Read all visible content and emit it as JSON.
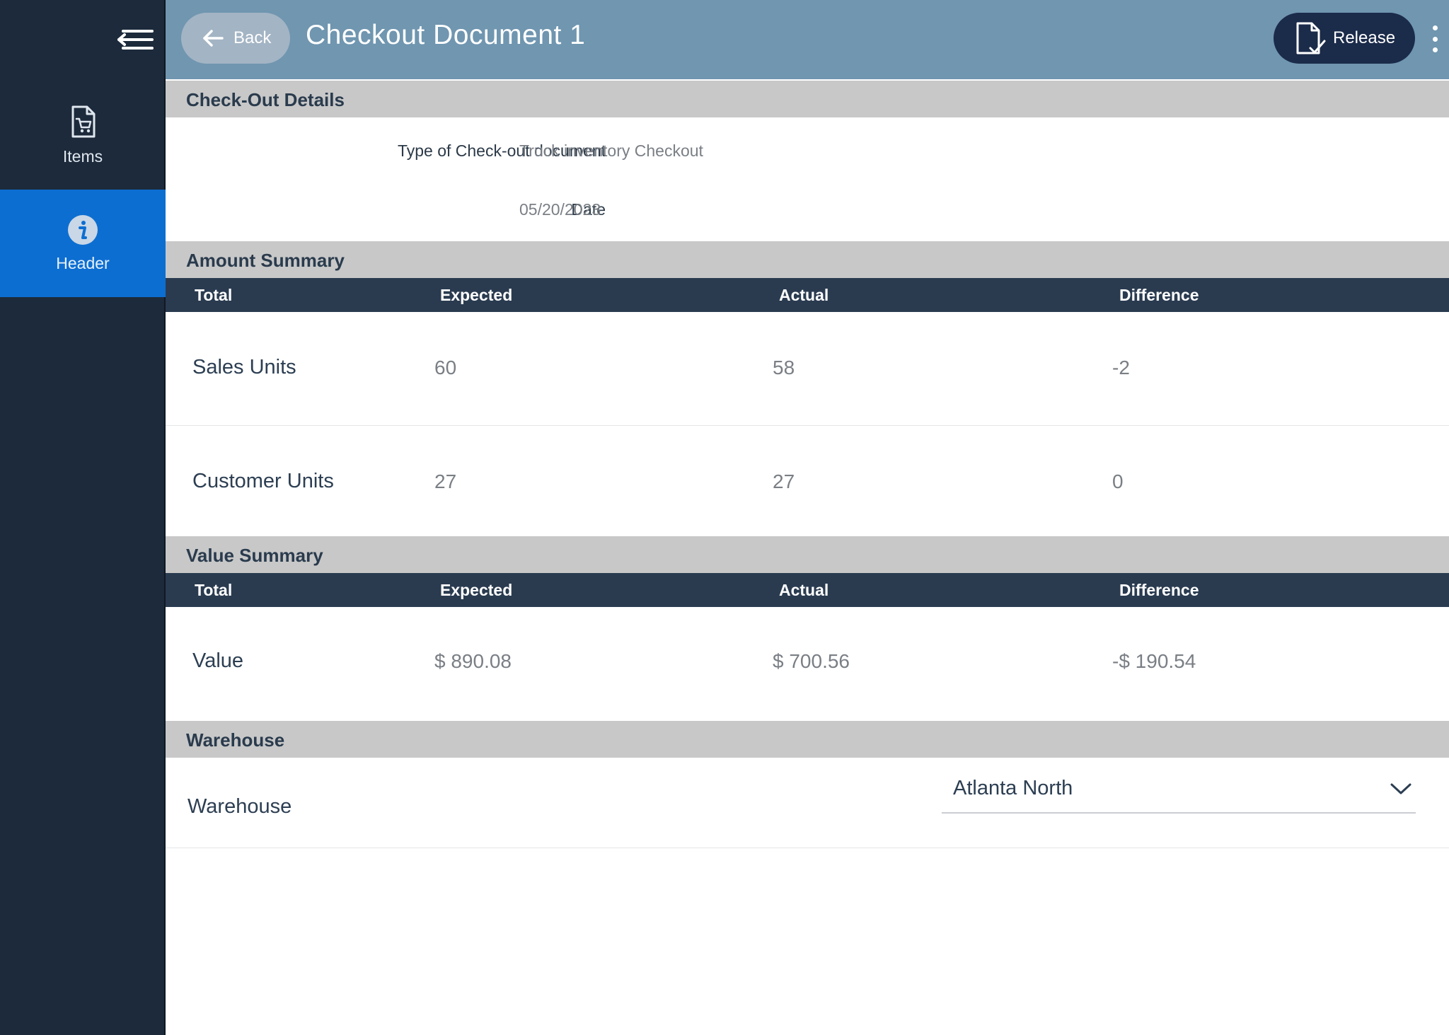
{
  "app": {
    "title": "Checkout Document 1"
  },
  "topbar": {
    "back_label": "Back",
    "release_label": "Release"
  },
  "sidebar": {
    "items": [
      {
        "label": "Items",
        "icon": "cart-document-icon",
        "active": false
      },
      {
        "label": "Header",
        "icon": "info-icon",
        "active": true
      }
    ]
  },
  "checkout_details": {
    "section_title": "Check-Out Details",
    "type_label": "Type of Check-out document",
    "type_value": "Truck inventory Checkout",
    "date_label": "Date",
    "date_value": "05/20/2023"
  },
  "amount_summary": {
    "section_title": "Amount Summary",
    "columns": [
      "Total",
      "Expected",
      "Actual",
      "Difference"
    ],
    "rows": [
      {
        "label": "Sales Units",
        "expected": "60",
        "actual": "58",
        "difference": "-2"
      },
      {
        "label": "Customer Units",
        "expected": "27",
        "actual": "27",
        "difference": "0"
      }
    ]
  },
  "value_summary": {
    "section_title": "Value Summary",
    "columns": [
      "Total",
      "Expected",
      "Actual",
      "Difference"
    ],
    "rows": [
      {
        "label": "Value",
        "expected": "$ 890.08",
        "actual": "$ 700.56",
        "difference": "-$ 190.54"
      }
    ]
  },
  "warehouse": {
    "section_title": "Warehouse",
    "field_label": "Warehouse",
    "selected": "Atlanta North"
  },
  "colors": {
    "sidebar_bg": "#1c2a3b",
    "sidebar_active": "#0d6ed1",
    "topbar_bg": "#7096b0",
    "release_bg": "#1b2b4a",
    "section_bar": "#c8c8c8",
    "table_header": "#2a3b50"
  }
}
